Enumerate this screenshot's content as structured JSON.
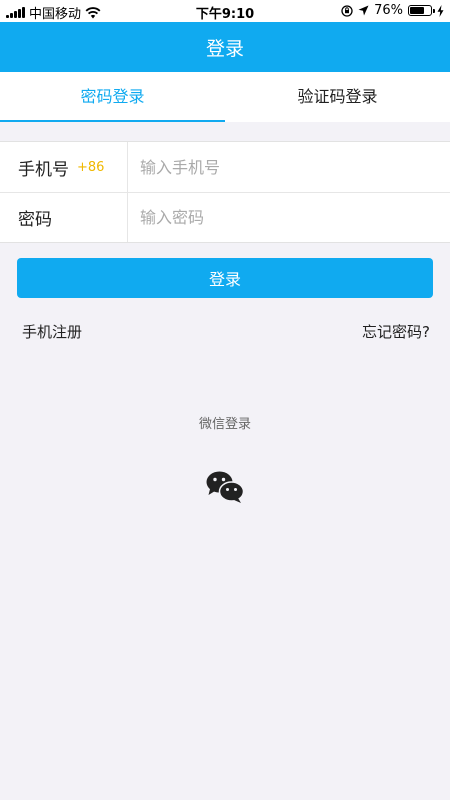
{
  "status": {
    "carrier": "中国移动",
    "time": "下午9:10",
    "battery": "76%",
    "battery_level": 0.76
  },
  "header": {
    "title": "登录"
  },
  "tabs": [
    {
      "label": "密码登录",
      "active": true
    },
    {
      "label": "验证码登录",
      "active": false
    }
  ],
  "form": {
    "phone": {
      "label": "手机号",
      "prefix": "+86",
      "placeholder": "输入手机号",
      "value": ""
    },
    "password": {
      "label": "密码",
      "placeholder": "输入密码",
      "value": ""
    }
  },
  "actions": {
    "login_label": "登录",
    "register_label": "手机注册",
    "forgot_label": "忘记密码?"
  },
  "social": {
    "label": "微信登录",
    "icon": "wechat-icon"
  },
  "colors": {
    "accent": "#10aaf0",
    "prefix": "#f0b800",
    "background": "#f3f2f7"
  }
}
